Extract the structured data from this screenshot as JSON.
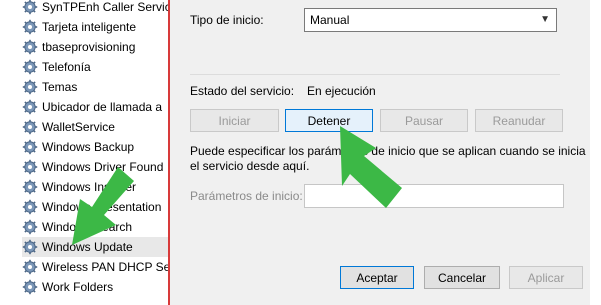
{
  "services": {
    "items": [
      {
        "label": "SynTPEnh Caller Servic",
        "selected": false
      },
      {
        "label": "Tarjeta inteligente",
        "selected": false
      },
      {
        "label": "tbaseprovisioning",
        "selected": false
      },
      {
        "label": "Telefonía",
        "selected": false
      },
      {
        "label": "Temas",
        "selected": false
      },
      {
        "label": "Ubicador de llamada a",
        "selected": false
      },
      {
        "label": "WalletService",
        "selected": false
      },
      {
        "label": "Windows Backup",
        "selected": false
      },
      {
        "label": "Windows Driver Found",
        "selected": false
      },
      {
        "label": "Windows Installer",
        "selected": false
      },
      {
        "label": "Windows Presentation",
        "selected": false
      },
      {
        "label": "Windows Search",
        "selected": false
      },
      {
        "label": "Windows Update",
        "selected": true
      },
      {
        "label": "Wireless PAN DHCP Se",
        "selected": false
      },
      {
        "label": "Work Folders",
        "selected": false
      }
    ]
  },
  "dialog": {
    "startup_type_label": "Tipo de inicio:",
    "startup_type_value": "Manual",
    "service_status_label": "Estado del servicio:",
    "service_status_value": "En ejecución",
    "buttons": {
      "start": "Iniciar",
      "stop": "Detener",
      "pause": "Pausar",
      "resume": "Reanudar"
    },
    "info_text_line1": "Puede especificar los parámetros de inicio que se aplican cuando se inicia",
    "info_text_line2": "el servicio desde aquí.",
    "start_params_label": "Parámetros de inicio:",
    "start_params_value": "",
    "footer": {
      "accept": "Aceptar",
      "cancel": "Cancelar",
      "apply": "Aplicar"
    }
  },
  "colors": {
    "annotation_arrow": "#3cb846",
    "focus_border": "#0078d7",
    "divider": "#d83a3a"
  },
  "icons": {
    "service_icon": "gear-icon",
    "dropdown_icon": "chevron-down-icon",
    "annotation_arrow": "arrow-icon"
  }
}
